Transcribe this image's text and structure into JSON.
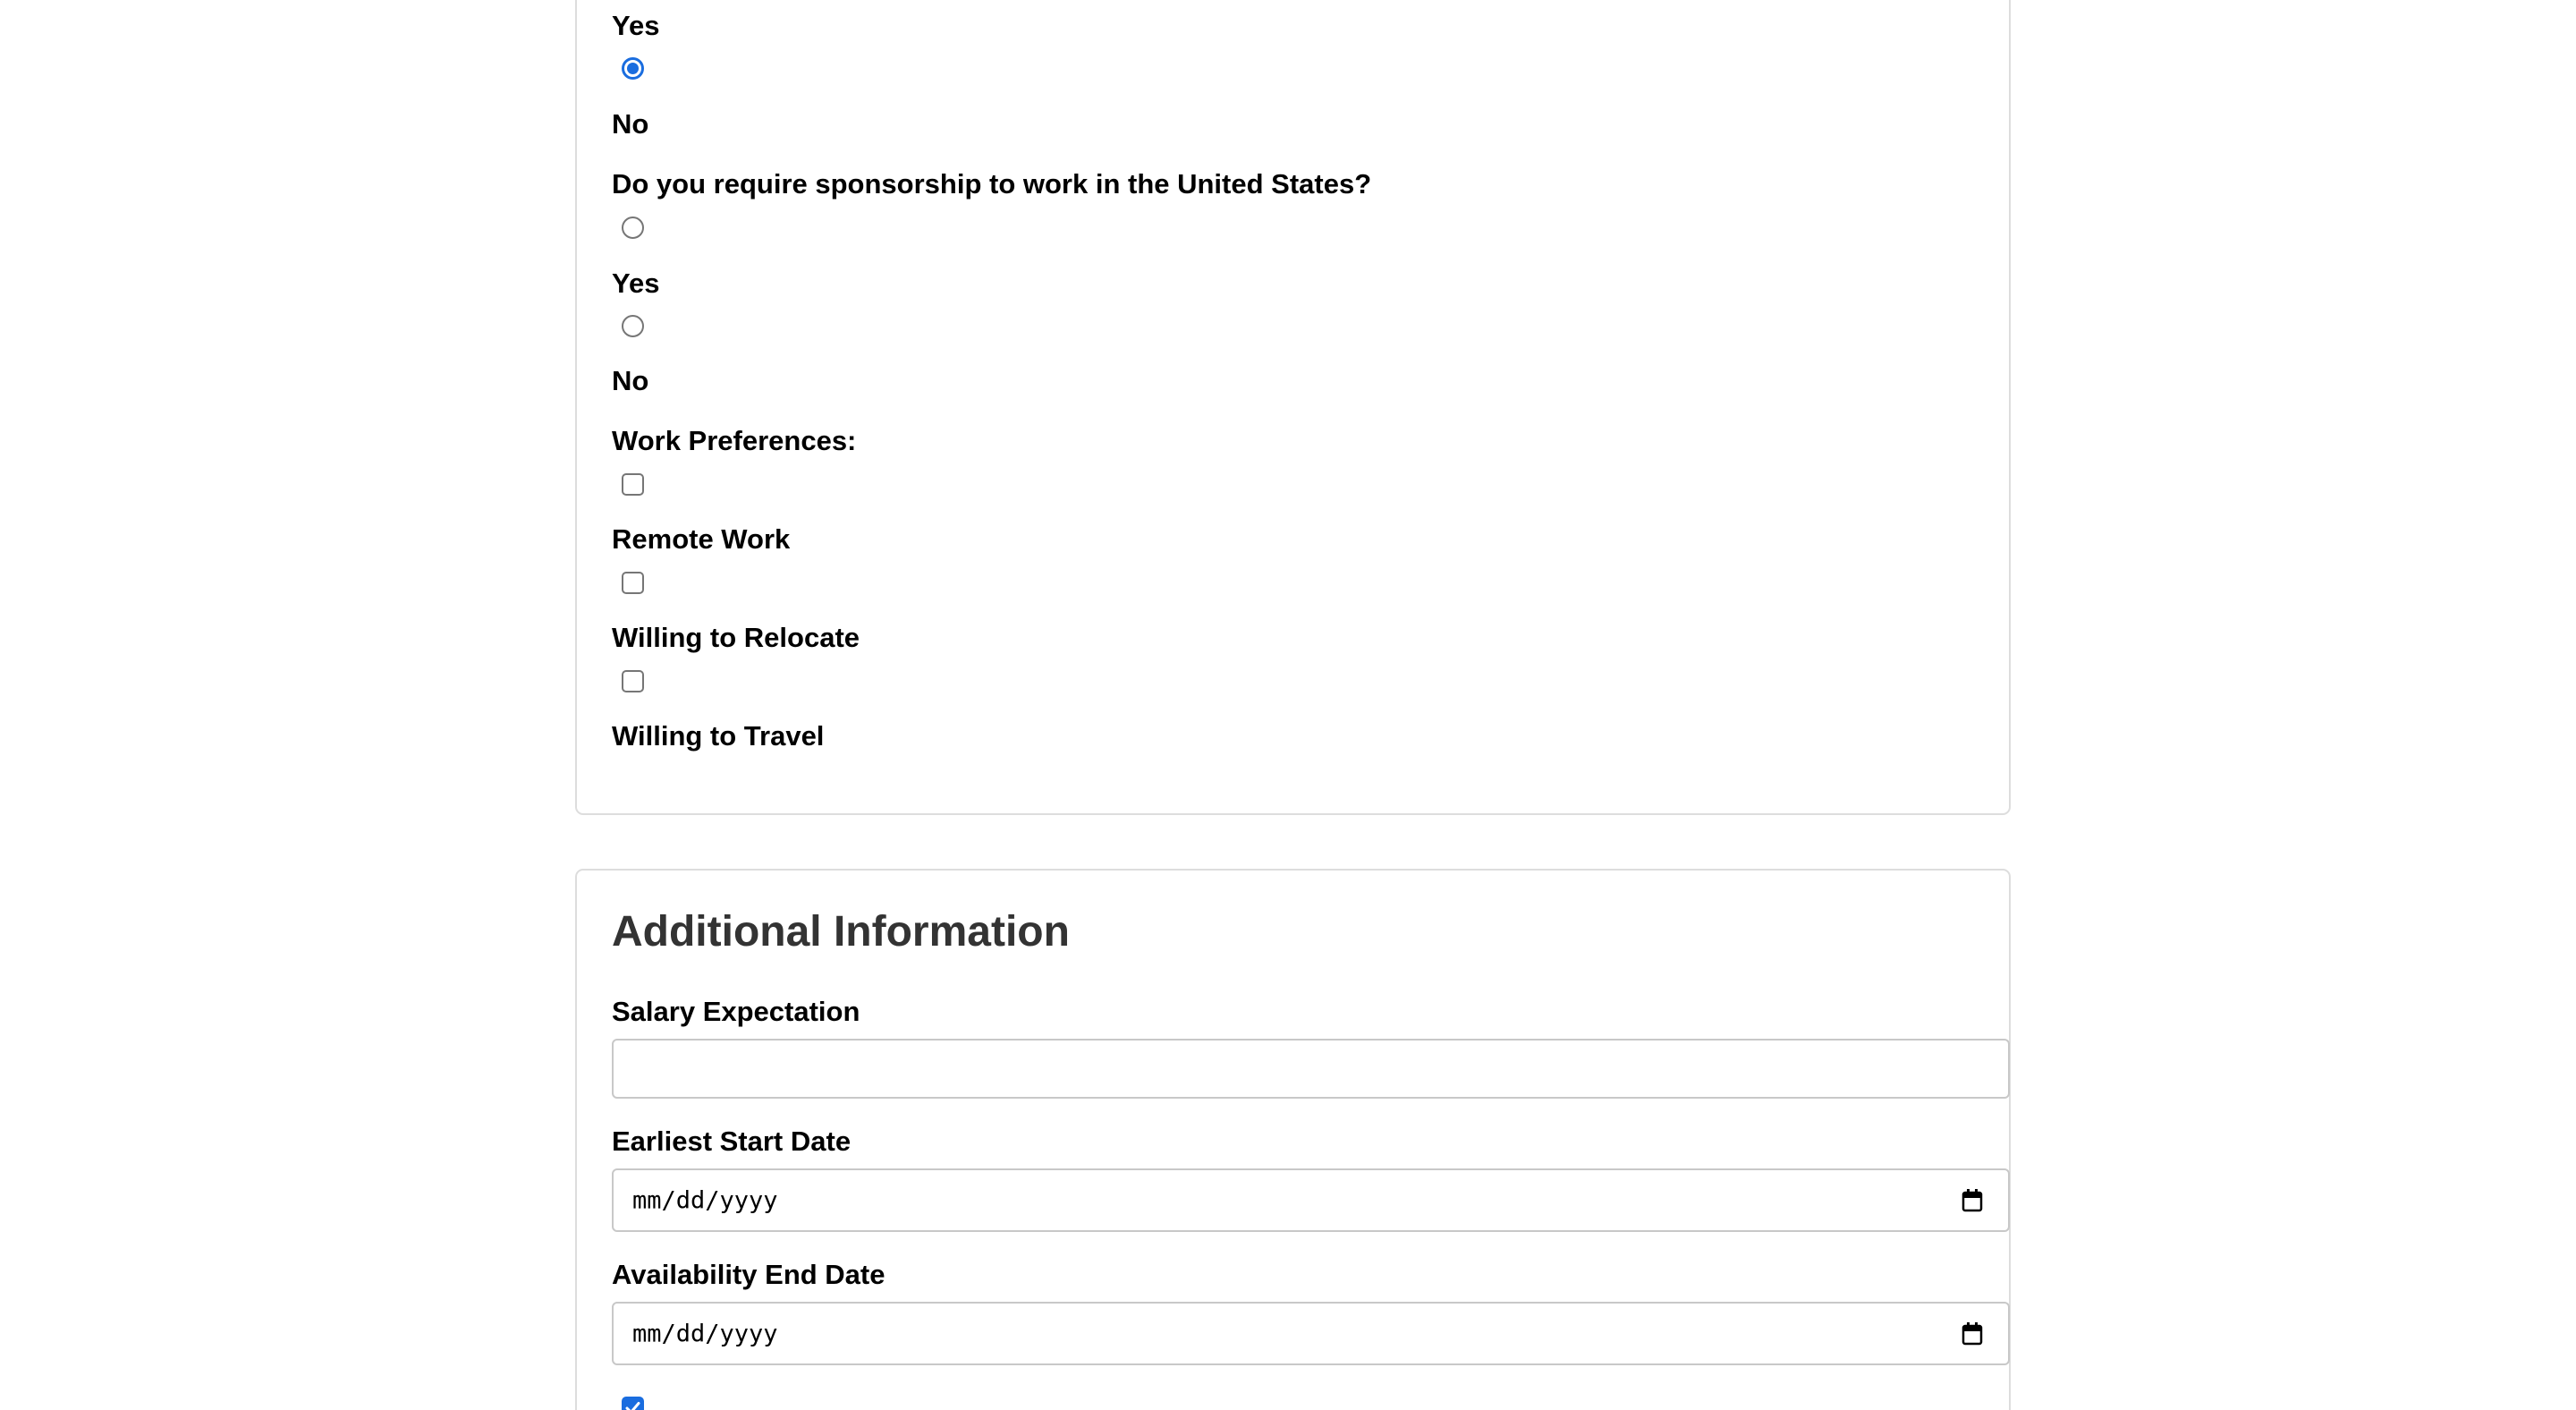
{
  "sponsorship_prev": {
    "option_yes": "Yes",
    "option_no": "No",
    "selected": "No"
  },
  "sponsorship": {
    "question": "Do you require sponsorship to work in the United States?",
    "option_yes": "Yes",
    "option_no": "No",
    "selected": null
  },
  "work_preferences": {
    "label": "Work Preferences:",
    "options": [
      {
        "label": "Remote Work",
        "checked": false
      },
      {
        "label": "Willing to Relocate",
        "checked": false
      },
      {
        "label": "Willing to Travel",
        "checked": false
      }
    ]
  },
  "additional_info": {
    "heading": "Additional Information",
    "salary_label": "Salary Expectation",
    "salary_value": "",
    "start_date_label": "Earliest Start Date",
    "start_date_placeholder": "mm/dd/yyyy",
    "end_date_label": "Availability End Date",
    "end_date_placeholder": "mm/dd/yyyy",
    "bottom_checkbox_checked": true
  },
  "colors": {
    "accent": "#1a6ddf",
    "heading": "#333333",
    "card_border": "#dddddd",
    "field_border": "#c8c8c8"
  },
  "icons": {
    "date_picker": "calendar-icon",
    "checkmark": "checkmark-icon"
  }
}
